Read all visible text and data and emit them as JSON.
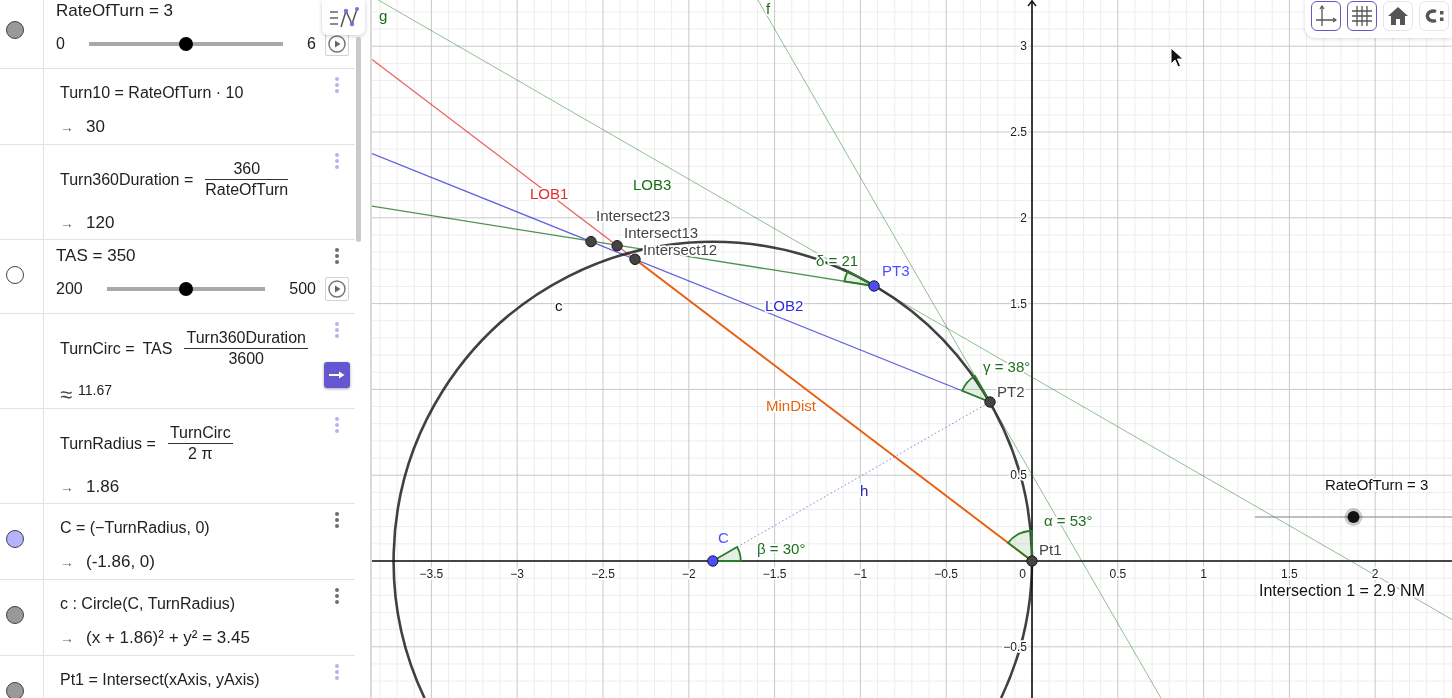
{
  "algebra_view": {
    "rows": [
      {
        "kind": "slider",
        "marker": {
          "visible": true,
          "color": "#999999"
        },
        "label": "RateOfTurn = 3",
        "min": "0",
        "max": "6",
        "level": 0.5
      },
      {
        "kind": "expression",
        "menu_tinted": true,
        "definition": "Turn10 = RateOfTurn · 10",
        "prefix": "→",
        "output": "30",
        "approximate": false
      },
      {
        "kind": "fraction",
        "menu_tinted": true,
        "lhs": "Turn360Duration =",
        "numerator": "360",
        "denominator": "RateOfTurn",
        "prefix": "→",
        "output": "120",
        "approximate": false
      },
      {
        "kind": "slider",
        "marker": {
          "visible": false
        },
        "menu_tinted": false,
        "label": "TAS = 350",
        "min": "200",
        "max": "500",
        "level": 0.5
      },
      {
        "kind": "fraction",
        "menu_tinted": true,
        "lhs": "TurnCirc =",
        "factor": "TAS",
        "numerator": "Turn360Duration",
        "denominator": "3600",
        "prefix": "≈",
        "output": "11.67",
        "approximate": true
      },
      {
        "kind": "fraction",
        "menu_tinted": true,
        "lhs": "TurnRadius =",
        "numerator": "TurnCirc",
        "denominator": "2 π",
        "prefix": "→",
        "output": "1.86",
        "approximate": false
      },
      {
        "kind": "expression",
        "marker": {
          "visible": true,
          "color": "#b3b3ff"
        },
        "menu_tinted": false,
        "definition": "C = (−TurnRadius, 0)",
        "prefix": "→",
        "output": "(-1.86, 0)",
        "approximate": false
      },
      {
        "kind": "expression",
        "marker": {
          "visible": true,
          "color": "#999999"
        },
        "menu_tinted": false,
        "definition": "c : Circle(C, TurnRadius)",
        "prefix": "→",
        "output": "(x + 1.86)² + y² = 3.45",
        "approximate": false
      },
      {
        "kind": "expression",
        "marker": {
          "visible": true,
          "color": "#999999"
        },
        "menu_tinted": true,
        "definition": "Pt1 = Intersect(xAxis, yAxis)"
      }
    ]
  },
  "graphics": {
    "style_bar": [
      {
        "kind": "axes",
        "selected": true
      },
      {
        "kind": "grid",
        "selected": true
      },
      {
        "kind": "home",
        "selected": false
      },
      {
        "kind": "arc",
        "selected": false
      }
    ],
    "x_ticks": [
      "−3.5",
      "−3",
      "−2.5",
      "−2",
      "−1.5",
      "−1",
      "−0.5",
      "0",
      "0.5",
      "1",
      "1.5",
      "2"
    ],
    "y_ticks": [
      "3",
      "2.5",
      "2",
      "1.5",
      "0.5",
      "−0.5"
    ],
    "curves": [
      {
        "kind": "line",
        "label": "g",
        "color": "#0f6e0f"
      },
      {
        "kind": "line",
        "label": "f",
        "color": "#0f6e0f"
      },
      {
        "kind": "ray",
        "label": "LOB1",
        "color": "#e32a2a"
      },
      {
        "kind": "ray",
        "label": "LOB3",
        "color": "#127012"
      },
      {
        "kind": "ray",
        "label": "LOB2",
        "color": "#2b2bd9"
      },
      {
        "kind": "segment",
        "label": "MinDist",
        "color": "#e8620f"
      },
      {
        "kind": "dotted",
        "label": "h",
        "color": "#1c1cc8"
      },
      {
        "kind": "circle",
        "label": "c",
        "color": "#111111"
      }
    ],
    "points": [
      {
        "label": "Intersect23",
        "color": "#444444"
      },
      {
        "label": "Intersect13",
        "color": "#444444"
      },
      {
        "label": "Intersect12",
        "color": "#444444"
      },
      {
        "label": "PT3",
        "color": "#4d4dff"
      },
      {
        "label": "PT2",
        "color": "#444444"
      },
      {
        "label": "Pt1",
        "color": "#444444"
      },
      {
        "label": "C",
        "color": "#4d4dff"
      }
    ],
    "angles": [
      {
        "label": "δ = 21"
      },
      {
        "label": "γ = 38°"
      },
      {
        "label": "α = 53°"
      },
      {
        "label": "β = 30°"
      }
    ],
    "slider": {
      "label": "RateOfTurn = 3",
      "level": 0.5
    },
    "caption": "Intersection 1 = 2.9 NM"
  }
}
